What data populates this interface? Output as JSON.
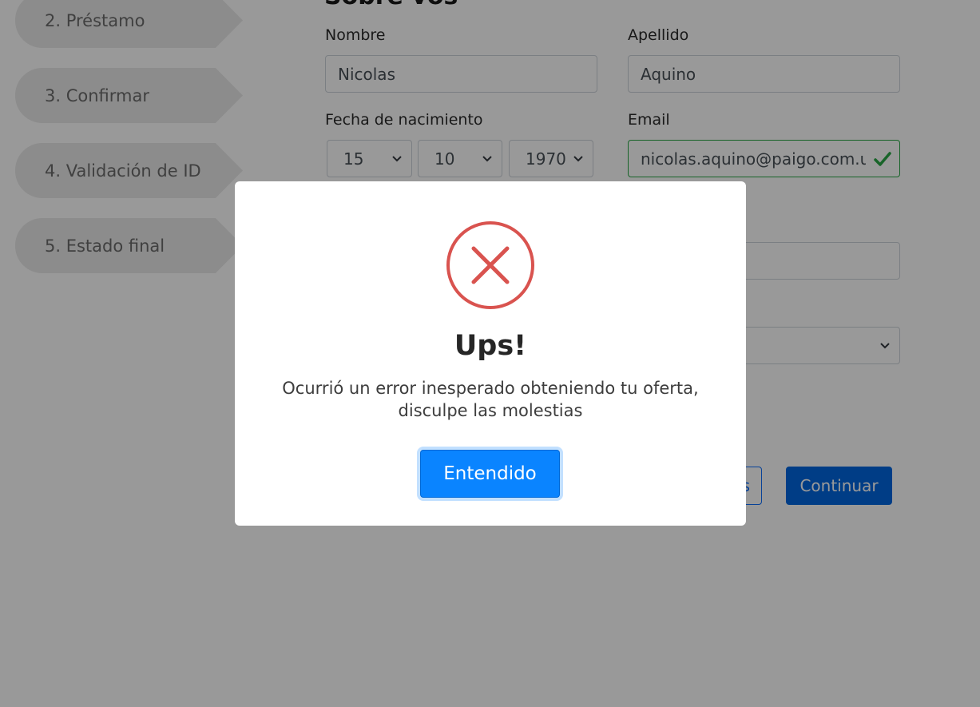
{
  "stepper": {
    "steps": [
      {
        "label": "2. Préstamo"
      },
      {
        "label": "3. Confirmar"
      },
      {
        "label": "4. Validación de ID"
      },
      {
        "label": "5. Estado final"
      }
    ]
  },
  "form": {
    "heading": "Sobre vos",
    "nombre": {
      "label": "Nombre",
      "value": "Nicolas"
    },
    "apellido": {
      "label": "Apellido",
      "value": "Aquino"
    },
    "fecha": {
      "label": "Fecha de nacimiento",
      "day": "15",
      "month": "10",
      "year": "1970"
    },
    "email": {
      "label": "Email",
      "value": "nicolas.aquino@paigo.com.uy"
    },
    "back_button_partial": "s",
    "continue_button": "Continuar"
  },
  "modal": {
    "title": "Ups!",
    "message_line1": "Ocurrió un error inesperado obteniendo tu oferta,",
    "message_line2": "disculpe las molestias",
    "button": "Entendido"
  },
  "colors": {
    "error": "#d9534f",
    "primary": "#0a84ff",
    "valid": "#28a745"
  }
}
